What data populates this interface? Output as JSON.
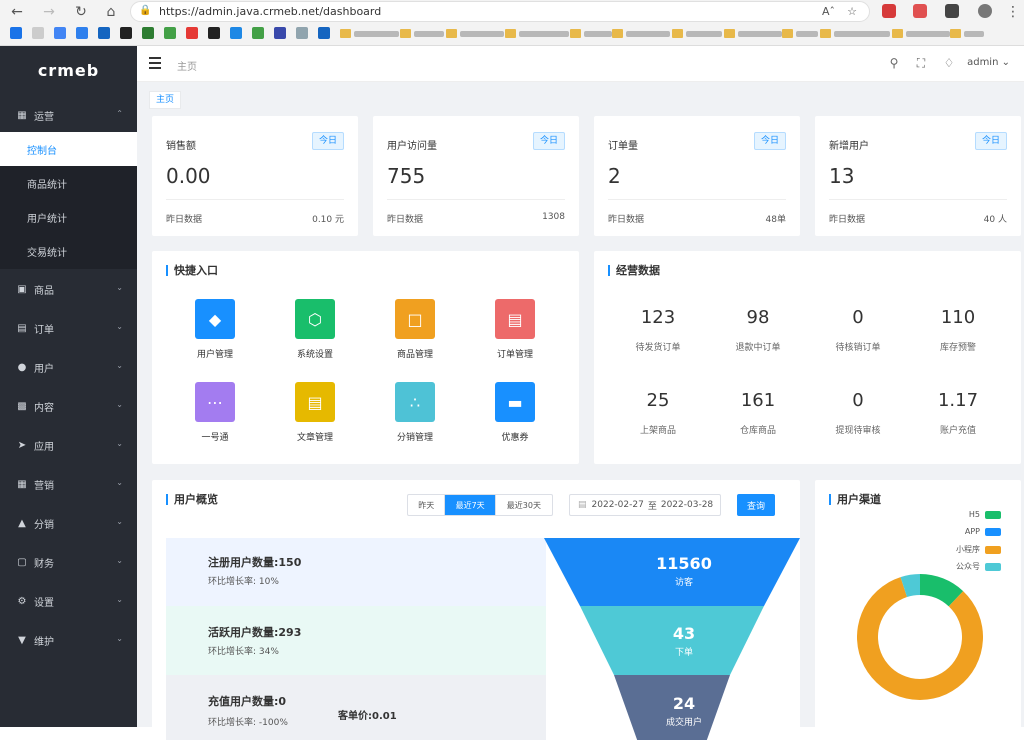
{
  "browser": {
    "url": "https://admin.java.crmeb.net/dashboard",
    "zoom_label": "Aˆ"
  },
  "sidebar": {
    "logo": "crmeb",
    "menu": [
      {
        "label": "运营",
        "expanded": true
      },
      {
        "label": "商品"
      },
      {
        "label": "订单"
      },
      {
        "label": "用户"
      },
      {
        "label": "内容"
      },
      {
        "label": "应用"
      },
      {
        "label": "营销"
      },
      {
        "label": "分销"
      },
      {
        "label": "财务"
      },
      {
        "label": "设置"
      },
      {
        "label": "维护"
      }
    ],
    "submenu": [
      {
        "label": "控制台",
        "active": true
      },
      {
        "label": "商品统计"
      },
      {
        "label": "用户统计"
      },
      {
        "label": "交易统计"
      }
    ]
  },
  "header": {
    "breadcrumb": "主页",
    "user": "admin"
  },
  "tabs": {
    "home": "主页"
  },
  "stats": [
    {
      "title": "销售额",
      "badge": "今日",
      "value": "0.00",
      "foot_label": "昨日数据",
      "foot_value": "0.10 元"
    },
    {
      "title": "用户访问量",
      "badge": "今日",
      "value": "755",
      "foot_label": "昨日数据",
      "foot_value": "1308"
    },
    {
      "title": "订单量",
      "badge": "今日",
      "value": "2",
      "foot_label": "昨日数据",
      "foot_value": "48单"
    },
    {
      "title": "新增用户",
      "badge": "今日",
      "value": "13",
      "foot_label": "昨日数据",
      "foot_value": "40 人"
    }
  ],
  "quick": {
    "title": "快捷入口",
    "items": [
      {
        "label": "用户管理",
        "color": "#1890ff",
        "icon": "user-manage-icon"
      },
      {
        "label": "系统设置",
        "color": "#19be6b",
        "icon": "settings-icon"
      },
      {
        "label": "商品管理",
        "color": "#f0a020",
        "icon": "bag-icon"
      },
      {
        "label": "订单管理",
        "color": "#ed6a6a",
        "icon": "clipboard-icon"
      },
      {
        "label": "一号通",
        "color": "#a37cf0",
        "icon": "chat-icon"
      },
      {
        "label": "文章管理",
        "color": "#e6b900",
        "icon": "article-icon"
      },
      {
        "label": "分销管理",
        "color": "#4ec2d6",
        "icon": "share-icon"
      },
      {
        "label": "优惠券",
        "color": "#1890ff",
        "icon": "ticket-icon"
      }
    ]
  },
  "ops": {
    "title": "经营数据",
    "items": [
      {
        "value": "123",
        "label": "待发货订单"
      },
      {
        "value": "98",
        "label": "退款中订单"
      },
      {
        "value": "0",
        "label": "待核销订单"
      },
      {
        "value": "110",
        "label": "库存预警"
      },
      {
        "value": "25",
        "label": "上架商品"
      },
      {
        "value": "161",
        "label": "仓库商品"
      },
      {
        "value": "0",
        "label": "提现待审核"
      },
      {
        "value": "1.17",
        "label": "账户充值"
      }
    ]
  },
  "overview": {
    "title": "用户概览",
    "ranges": [
      "昨天",
      "最近7天",
      "最近30天"
    ],
    "active_range": "最近7天",
    "date_start": "2022-02-27",
    "date_sep": "至",
    "date_end": "2022-03-28",
    "query": "查询",
    "rows": [
      {
        "title": "注册用户数量:150",
        "sub": "环比增长率:  10%",
        "bg": "#eef4ff"
      },
      {
        "title": "活跃用户数量:293",
        "sub": "环比增长率:  34%",
        "bg": "#e9f9f5"
      },
      {
        "title": "充值用户数量:0",
        "sub": "环比增长率:  -100%",
        "bg": "#eef0f4"
      }
    ],
    "unit_price": "客单价:0.01",
    "funnel": [
      {
        "value": "11560",
        "label": "访客",
        "color": "#1a88f5"
      },
      {
        "value": "43",
        "label": "下单",
        "color": "#4ec9d6"
      },
      {
        "value": "24",
        "label": "成交用户",
        "color": "#5a6e94"
      }
    ]
  },
  "channel": {
    "title": "用户渠道",
    "chart_data": {
      "type": "pie",
      "series": [
        {
          "name": "H5",
          "color": "#19be6b",
          "value": 12
        },
        {
          "name": "APP",
          "color": "#1890ff",
          "value": 0
        },
        {
          "name": "小程序",
          "color": "#f0a020",
          "value": 83
        },
        {
          "name": "公众号",
          "color": "#4ec9d6",
          "value": 5
        }
      ],
      "legend": "top-right"
    }
  }
}
